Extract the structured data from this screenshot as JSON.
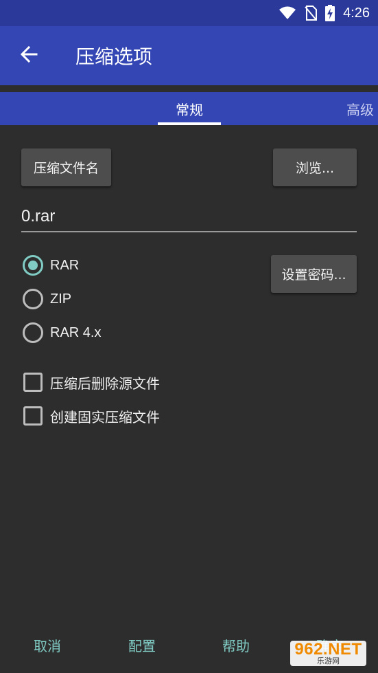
{
  "status_bar": {
    "time": "4:26",
    "icons": [
      "wifi-icon",
      "no-sim-icon",
      "battery-charging-icon"
    ]
  },
  "app_bar": {
    "title": "压缩选项",
    "back_icon": "arrow-left-icon"
  },
  "tabs": [
    {
      "label": "常规",
      "active": true
    },
    {
      "label": "高级",
      "active": false
    }
  ],
  "general": {
    "archive_name_button": "压缩文件名",
    "browse_button": "浏览...",
    "archive_name_value": "0.rar",
    "set_password_button": "设置密码...",
    "formats": [
      {
        "label": "RAR",
        "checked": true
      },
      {
        "label": "ZIP",
        "checked": false
      },
      {
        "label": "RAR 4.x",
        "checked": false
      }
    ],
    "options": [
      {
        "label": "压缩后删除源文件",
        "checked": false
      },
      {
        "label": "创建固实压缩文件",
        "checked": false
      }
    ]
  },
  "bottom_bar": {
    "cancel": "取消",
    "profiles": "配置",
    "help": "帮助",
    "ok": "确定"
  },
  "watermark": {
    "main": "962.NET",
    "sub": "乐游网"
  },
  "colors": {
    "status_bar": "#2b3a9a",
    "app_bar": "#3446b4",
    "background": "#2d2d2d",
    "accent": "#80cbc4",
    "button": "#4d4d4d"
  }
}
